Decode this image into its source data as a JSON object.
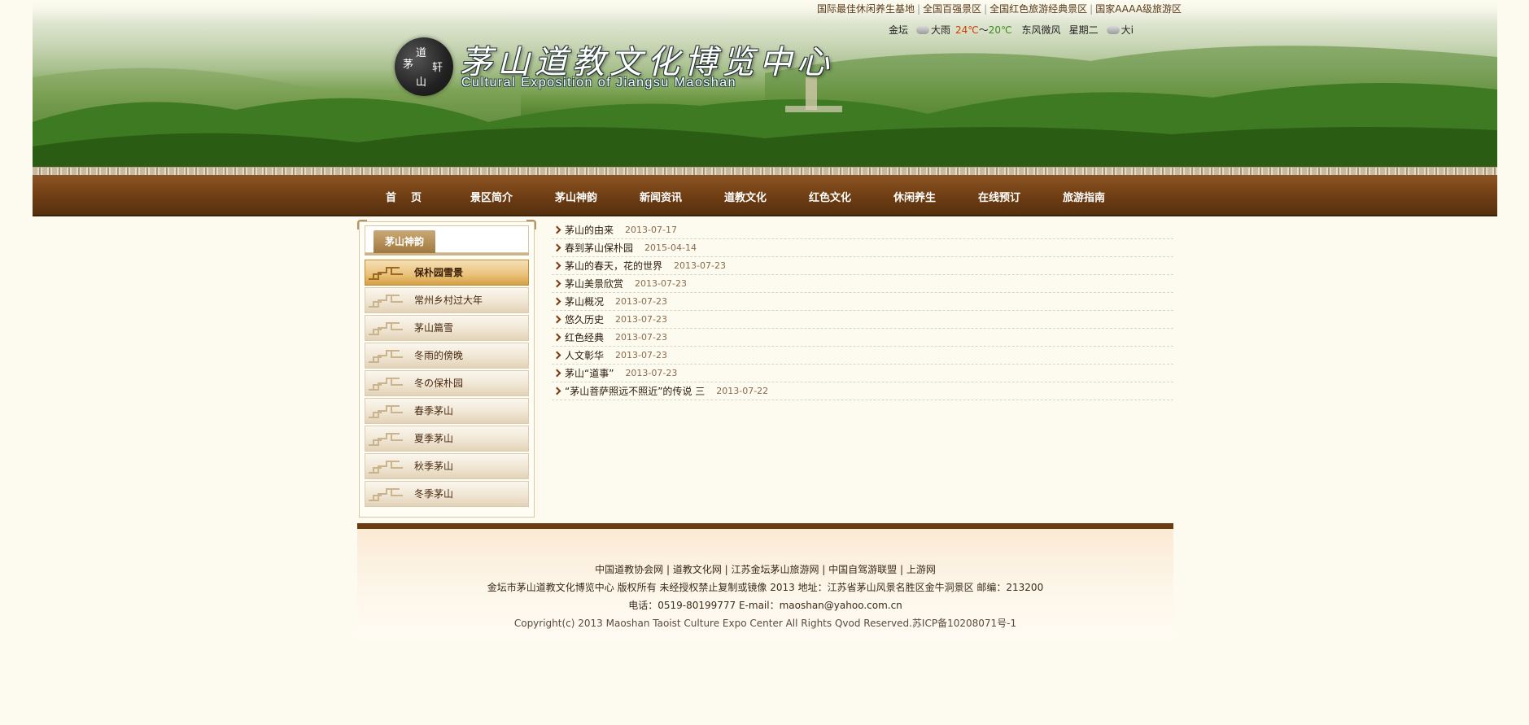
{
  "header": {
    "top_links": [
      "国际最佳休闲养生基地",
      "全国百强景区",
      "全国红色旅游经典景区",
      "国家AAAA级旅游区"
    ],
    "weather": {
      "city": "金坛",
      "condition": "大雨",
      "temp_high": "24℃",
      "separator": "～",
      "temp_low": "20℃",
      "wind": "东风微风",
      "weekday": "星期二",
      "next_condition": "大i",
      "icon": "rain-cloud-icon"
    },
    "logo_seal_chars": [
      "茅",
      "道",
      "轩",
      "山"
    ],
    "logo_title": "茅山道教文化博览中心",
    "logo_subtitle": "Cultural Exposition of Jiangsu Maoshan"
  },
  "nav": {
    "items": [
      "首页",
      "景区简介",
      "茅山神韵",
      "新闻资讯",
      "道教文化",
      "红色文化",
      "休闲养生",
      "在线预订",
      "旅游指南"
    ]
  },
  "sidebar": {
    "tab_label": "茅山神韵",
    "items": [
      {
        "label": "保朴园雪景",
        "active": true
      },
      {
        "label": "常州乡村过大年",
        "active": false
      },
      {
        "label": "茅山篇雪",
        "active": false
      },
      {
        "label": "冬雨的傍晚",
        "active": false
      },
      {
        "label": "冬の保朴园",
        "active": false
      },
      {
        "label": "春季茅山",
        "active": false
      },
      {
        "label": "夏季茅山",
        "active": false
      },
      {
        "label": "秋季茅山",
        "active": false
      },
      {
        "label": "冬季茅山",
        "active": false
      }
    ]
  },
  "articles": [
    {
      "title": "茅山的由来",
      "date": "2013-07-17"
    },
    {
      "title": "春到茅山保朴园",
      "date": "2015-04-14"
    },
    {
      "title": "茅山的春天，花的世界",
      "date": "2013-07-23"
    },
    {
      "title": "茅山美景欣赏",
      "date": "2013-07-23"
    },
    {
      "title": "茅山概况",
      "date": "2013-07-23"
    },
    {
      "title": "悠久历史",
      "date": "2013-07-23"
    },
    {
      "title": "红色经典",
      "date": "2013-07-23"
    },
    {
      "title": "人文彰华",
      "date": "2013-07-23"
    },
    {
      "title": "茅山“道事”",
      "date": "2013-07-23"
    },
    {
      "title": "“茅山菩萨照远不照近”的传说 三",
      "date": "2013-07-22"
    }
  ],
  "footer": {
    "links": "中国道教协会网 | 道教文化网 | 江苏金坛茅山旅游网 | 中国自驾游联盟 | 上游网",
    "copyright_cn": "金坛市茅山道教文化博览中心 版权所有 未经授权禁止复制或镜像 2013 地址：江苏省茅山风景名胜区金牛洞景区 邮编：213200",
    "contact": "电话：0519-80199777 E-mail：maoshan@yahoo.com.cn",
    "copyright_en": "Copyright(c) 2013 Maoshan Taoist Culture Expo Center All Rights Qvod Reserved.苏ICP备10208071号-1"
  },
  "colors": {
    "nav_bg": "#6e3d13",
    "accent_gold": "#d59f45",
    "page_bg": "#fdfbef"
  }
}
